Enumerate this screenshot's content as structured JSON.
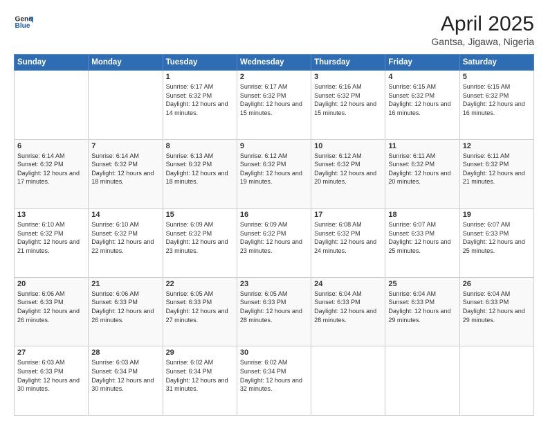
{
  "logo": {
    "text_general": "General",
    "text_blue": "Blue"
  },
  "title": "April 2025",
  "subtitle": "Gantsa, Jigawa, Nigeria",
  "days_of_week": [
    "Sunday",
    "Monday",
    "Tuesday",
    "Wednesday",
    "Thursday",
    "Friday",
    "Saturday"
  ],
  "weeks": [
    [
      {
        "day": "",
        "detail": ""
      },
      {
        "day": "",
        "detail": ""
      },
      {
        "day": "1",
        "detail": "Sunrise: 6:17 AM\nSunset: 6:32 PM\nDaylight: 12 hours and 14 minutes."
      },
      {
        "day": "2",
        "detail": "Sunrise: 6:17 AM\nSunset: 6:32 PM\nDaylight: 12 hours and 15 minutes."
      },
      {
        "day": "3",
        "detail": "Sunrise: 6:16 AM\nSunset: 6:32 PM\nDaylight: 12 hours and 15 minutes."
      },
      {
        "day": "4",
        "detail": "Sunrise: 6:15 AM\nSunset: 6:32 PM\nDaylight: 12 hours and 16 minutes."
      },
      {
        "day": "5",
        "detail": "Sunrise: 6:15 AM\nSunset: 6:32 PM\nDaylight: 12 hours and 16 minutes."
      }
    ],
    [
      {
        "day": "6",
        "detail": "Sunrise: 6:14 AM\nSunset: 6:32 PM\nDaylight: 12 hours and 17 minutes."
      },
      {
        "day": "7",
        "detail": "Sunrise: 6:14 AM\nSunset: 6:32 PM\nDaylight: 12 hours and 18 minutes."
      },
      {
        "day": "8",
        "detail": "Sunrise: 6:13 AM\nSunset: 6:32 PM\nDaylight: 12 hours and 18 minutes."
      },
      {
        "day": "9",
        "detail": "Sunrise: 6:12 AM\nSunset: 6:32 PM\nDaylight: 12 hours and 19 minutes."
      },
      {
        "day": "10",
        "detail": "Sunrise: 6:12 AM\nSunset: 6:32 PM\nDaylight: 12 hours and 20 minutes."
      },
      {
        "day": "11",
        "detail": "Sunrise: 6:11 AM\nSunset: 6:32 PM\nDaylight: 12 hours and 20 minutes."
      },
      {
        "day": "12",
        "detail": "Sunrise: 6:11 AM\nSunset: 6:32 PM\nDaylight: 12 hours and 21 minutes."
      }
    ],
    [
      {
        "day": "13",
        "detail": "Sunrise: 6:10 AM\nSunset: 6:32 PM\nDaylight: 12 hours and 21 minutes."
      },
      {
        "day": "14",
        "detail": "Sunrise: 6:10 AM\nSunset: 6:32 PM\nDaylight: 12 hours and 22 minutes."
      },
      {
        "day": "15",
        "detail": "Sunrise: 6:09 AM\nSunset: 6:32 PM\nDaylight: 12 hours and 23 minutes."
      },
      {
        "day": "16",
        "detail": "Sunrise: 6:09 AM\nSunset: 6:32 PM\nDaylight: 12 hours and 23 minutes."
      },
      {
        "day": "17",
        "detail": "Sunrise: 6:08 AM\nSunset: 6:32 PM\nDaylight: 12 hours and 24 minutes."
      },
      {
        "day": "18",
        "detail": "Sunrise: 6:07 AM\nSunset: 6:33 PM\nDaylight: 12 hours and 25 minutes."
      },
      {
        "day": "19",
        "detail": "Sunrise: 6:07 AM\nSunset: 6:33 PM\nDaylight: 12 hours and 25 minutes."
      }
    ],
    [
      {
        "day": "20",
        "detail": "Sunrise: 6:06 AM\nSunset: 6:33 PM\nDaylight: 12 hours and 26 minutes."
      },
      {
        "day": "21",
        "detail": "Sunrise: 6:06 AM\nSunset: 6:33 PM\nDaylight: 12 hours and 26 minutes."
      },
      {
        "day": "22",
        "detail": "Sunrise: 6:05 AM\nSunset: 6:33 PM\nDaylight: 12 hours and 27 minutes."
      },
      {
        "day": "23",
        "detail": "Sunrise: 6:05 AM\nSunset: 6:33 PM\nDaylight: 12 hours and 28 minutes."
      },
      {
        "day": "24",
        "detail": "Sunrise: 6:04 AM\nSunset: 6:33 PM\nDaylight: 12 hours and 28 minutes."
      },
      {
        "day": "25",
        "detail": "Sunrise: 6:04 AM\nSunset: 6:33 PM\nDaylight: 12 hours and 29 minutes."
      },
      {
        "day": "26",
        "detail": "Sunrise: 6:04 AM\nSunset: 6:33 PM\nDaylight: 12 hours and 29 minutes."
      }
    ],
    [
      {
        "day": "27",
        "detail": "Sunrise: 6:03 AM\nSunset: 6:33 PM\nDaylight: 12 hours and 30 minutes."
      },
      {
        "day": "28",
        "detail": "Sunrise: 6:03 AM\nSunset: 6:34 PM\nDaylight: 12 hours and 30 minutes."
      },
      {
        "day": "29",
        "detail": "Sunrise: 6:02 AM\nSunset: 6:34 PM\nDaylight: 12 hours and 31 minutes."
      },
      {
        "day": "30",
        "detail": "Sunrise: 6:02 AM\nSunset: 6:34 PM\nDaylight: 12 hours and 32 minutes."
      },
      {
        "day": "",
        "detail": ""
      },
      {
        "day": "",
        "detail": ""
      },
      {
        "day": "",
        "detail": ""
      }
    ]
  ]
}
